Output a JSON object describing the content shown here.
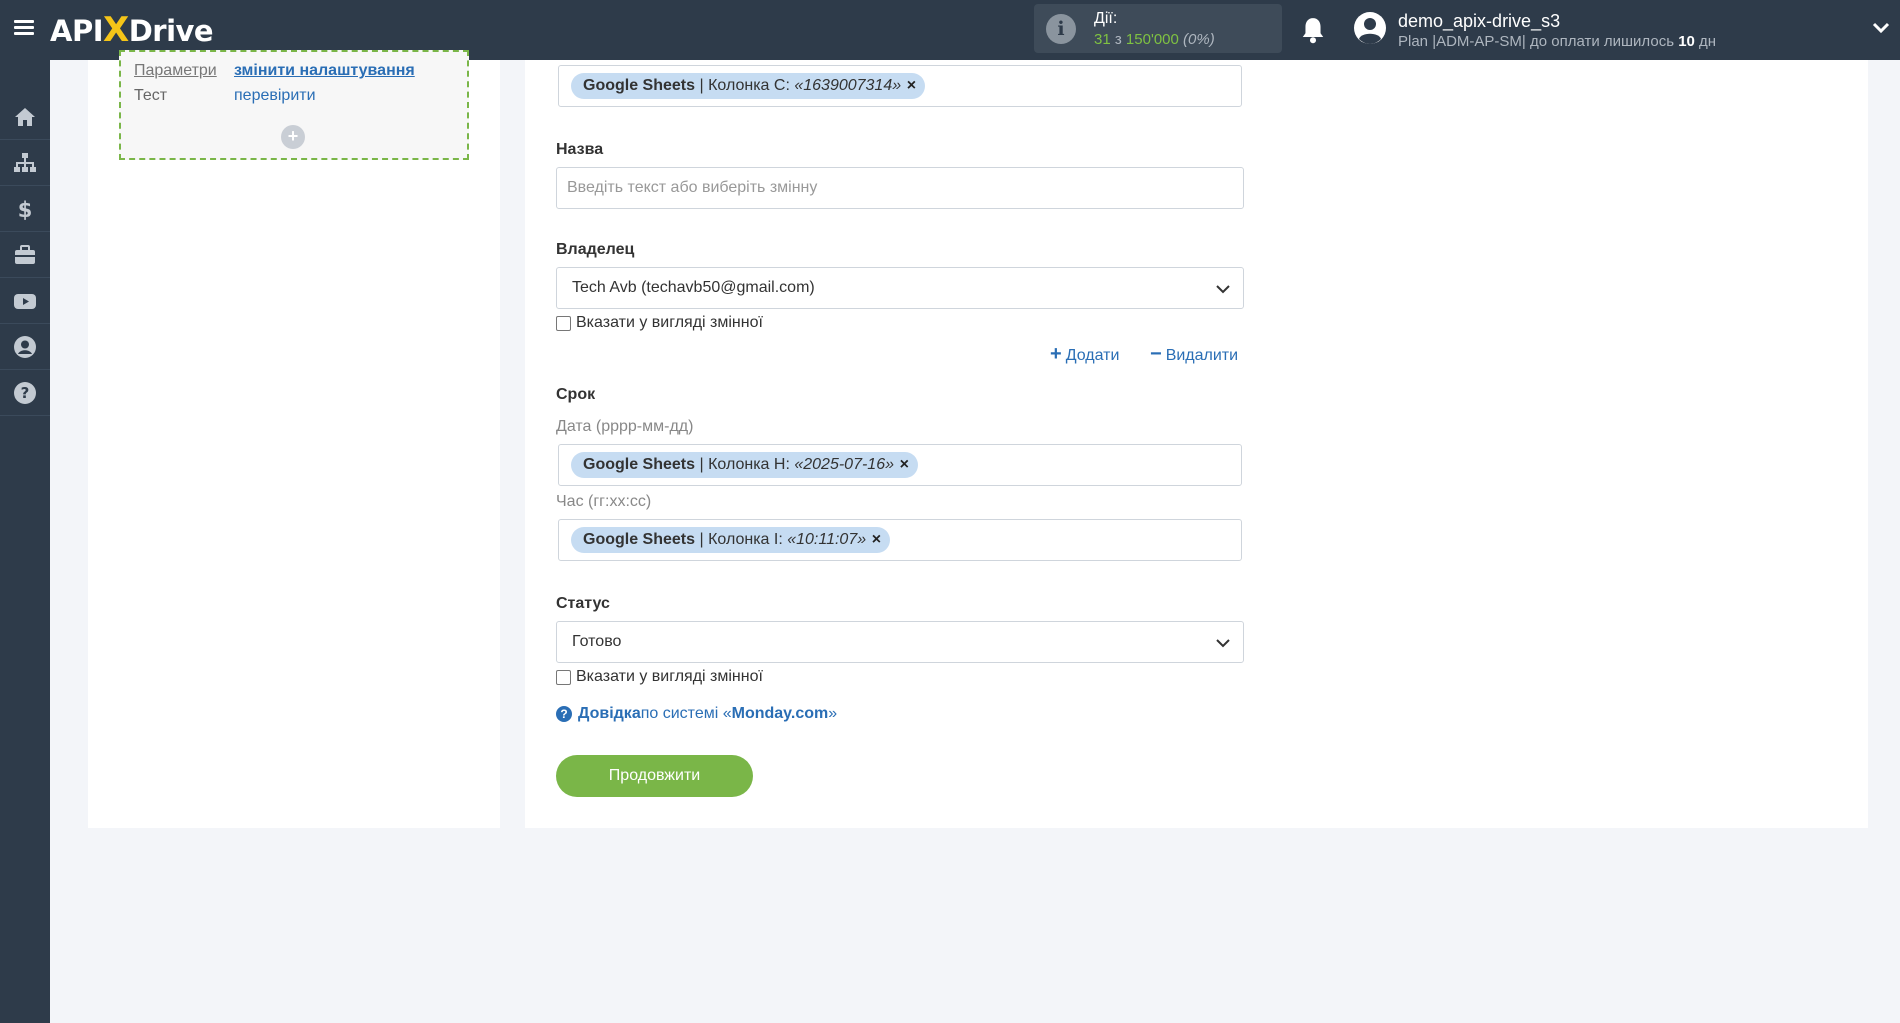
{
  "topbar": {
    "logo": {
      "part1": "API",
      "part2": "X",
      "part3": "Drive"
    },
    "actions": {
      "label": "Дії:",
      "used": "31",
      "of": "з",
      "limit": "150'000",
      "percent": "(0%)"
    },
    "user": {
      "name": "demo_apix-drive_s3",
      "plan_prefix": "Plan |ADM-AP-SM| до оплати лишилось",
      "days": "10",
      "days_suffix": "дн"
    }
  },
  "sidebar": {
    "items": [
      "home-icon",
      "sitemap-icon",
      "dollar-icon",
      "briefcase-icon",
      "youtube-icon",
      "user-icon",
      "help-icon"
    ]
  },
  "left": {
    "rows": [
      {
        "label": "Параметри",
        "link": "змінити налаштування"
      },
      {
        "label": "Тест",
        "link": "перевірити"
      }
    ],
    "add": "+"
  },
  "form": {
    "top_tag": {
      "source": "Google Sheets",
      "column": " | Колонка C: ",
      "value": "«1639007314»",
      "remove": "×"
    },
    "name": {
      "label": "Назва",
      "placeholder": "Введіть текст або виберіть змінну"
    },
    "owner": {
      "label": "Владелец",
      "value": "Tech Avb (techavb50@gmail.com)",
      "as_variable": "Вказати у вигляді змінної",
      "add": "Додати",
      "remove": "Видалити"
    },
    "deadline": {
      "label": "Срок",
      "date_label": "Дата (рррр-мм-дд)",
      "date_tag": {
        "source": "Google Sheets",
        "column": " | Колонка H: ",
        "value": "«2025-07-16»",
        "remove": "×"
      },
      "time_label": "Час (гг:хх:сс)",
      "time_tag": {
        "source": "Google Sheets",
        "column": " | Колонка I: ",
        "value": "«10:11:07»",
        "remove": "×"
      }
    },
    "status": {
      "label": "Статус",
      "value": "Готово",
      "as_variable": "Вказати у вигляді змінної"
    },
    "help": {
      "bold": "Довідка",
      "middle": " по системі «",
      "system": "Monday.com",
      "end": "»"
    },
    "continue": "Продовжити"
  },
  "colors": {
    "topbar": "#2e3b4a",
    "accent_green": "#7ab648",
    "link_blue": "#2a6eb5",
    "tag_bg": "#c6dcf2"
  }
}
